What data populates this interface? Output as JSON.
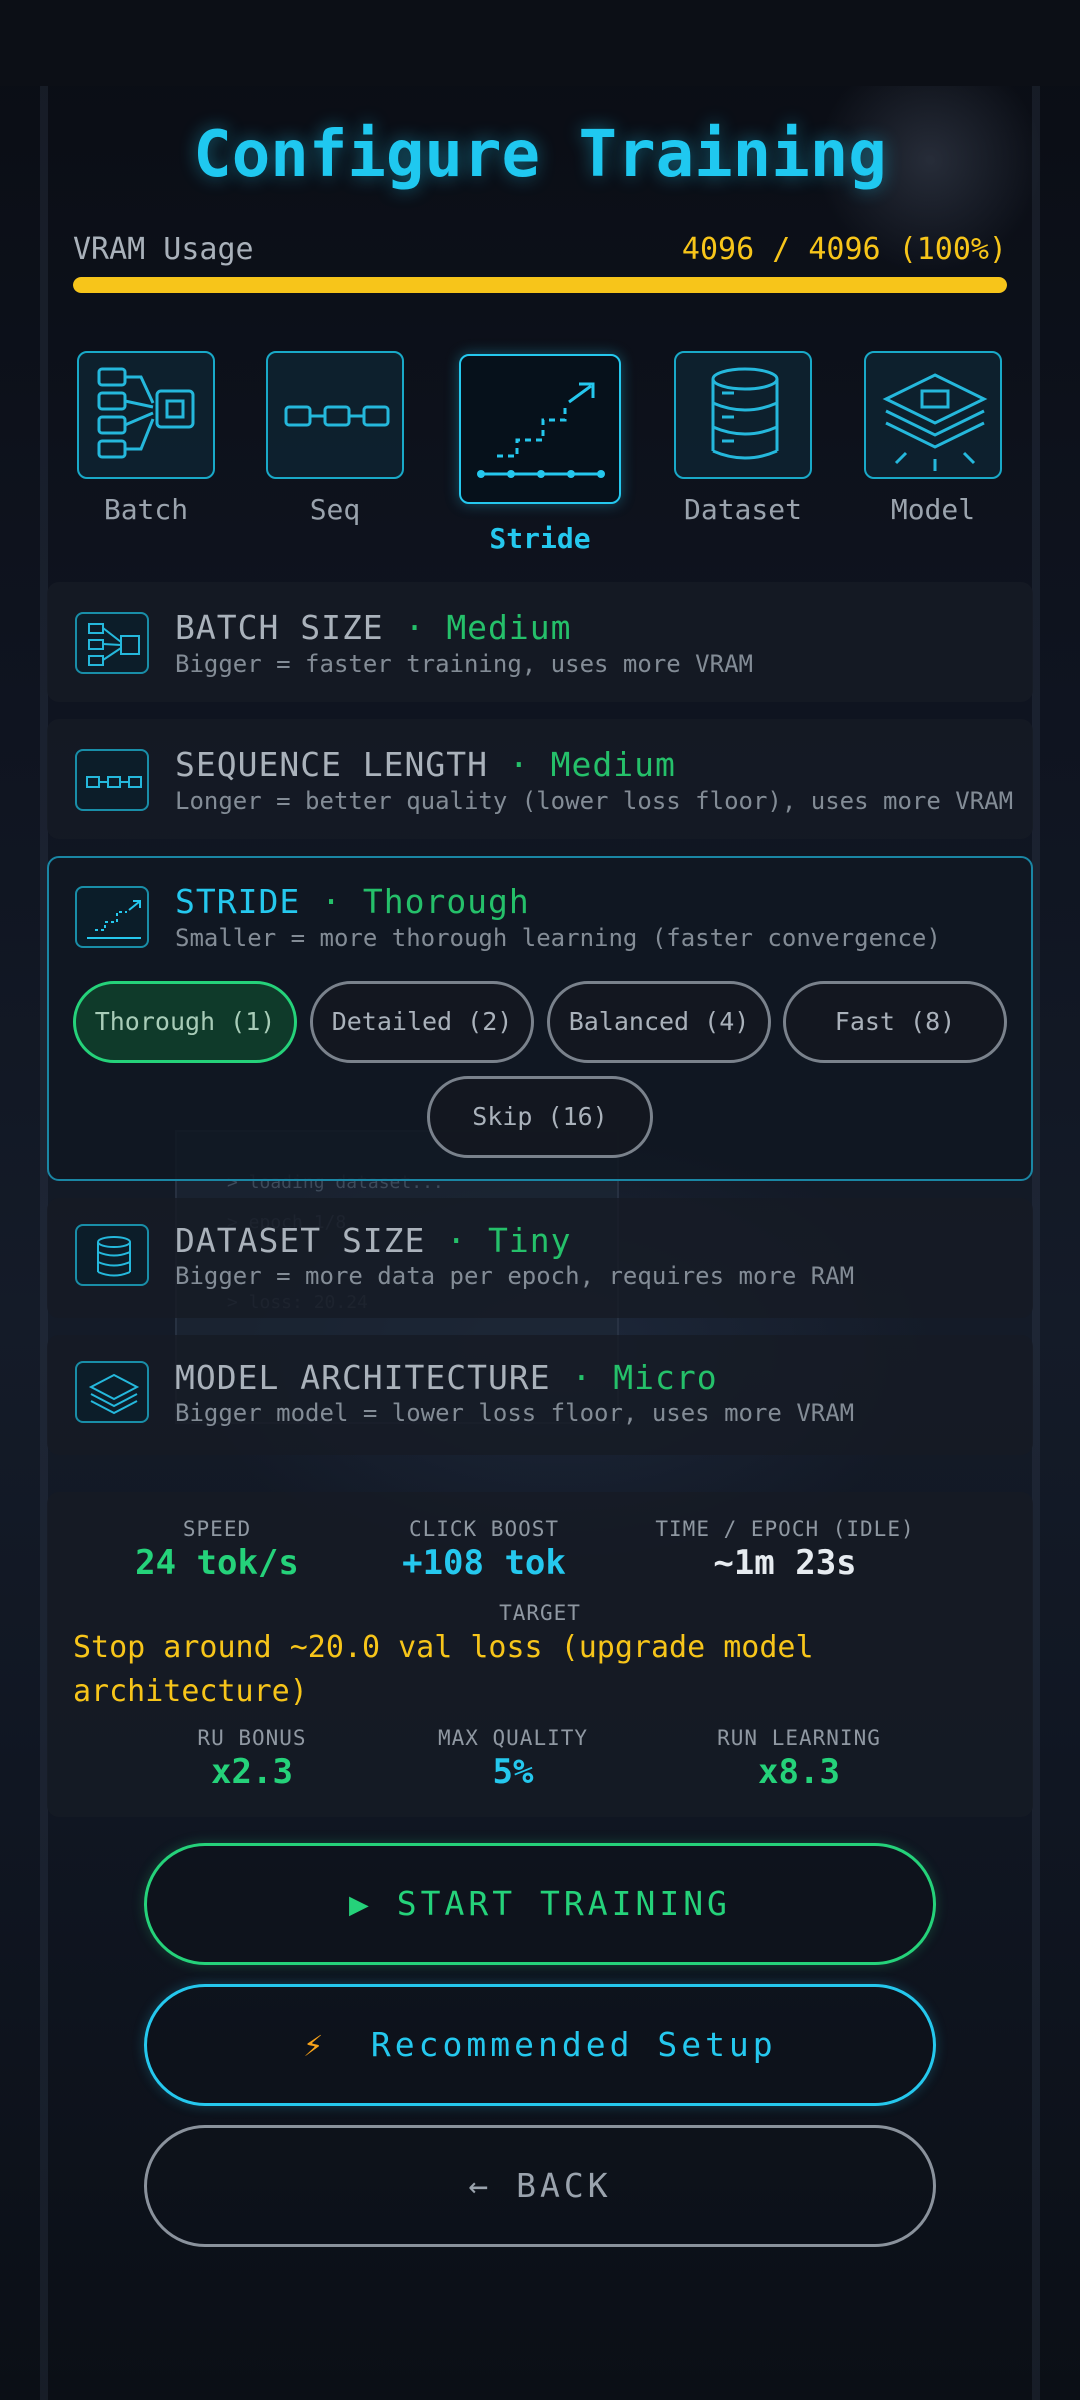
{
  "title": "Configure Training",
  "vram": {
    "label": "VRAM Usage",
    "value": "4096 / 4096 (100%)",
    "fill_fraction": 1.0,
    "color": "#f7c51a"
  },
  "tiles": [
    {
      "label": "Batch",
      "icon": "batch-icon"
    },
    {
      "label": "Seq",
      "icon": "sequence-icon"
    },
    {
      "label": "Stride",
      "icon": "stride-icon",
      "selected": true
    },
    {
      "label": "Dataset",
      "icon": "database-icon"
    },
    {
      "label": "Model",
      "icon": "model-layers-icon"
    }
  ],
  "rows": [
    {
      "name": "BATCH SIZE",
      "separator": "·",
      "level": "Medium",
      "desc": "Bigger = faster training, uses more VRAM"
    },
    {
      "name": "SEQUENCE LENGTH",
      "separator": "·",
      "level": "Medium",
      "desc": "Longer = better quality (lower loss floor), uses more VRAM"
    },
    {
      "name": "STRIDE",
      "separator": "·",
      "level": "Thorough",
      "desc": "Smaller = more thorough learning (faster convergence)"
    },
    {
      "name": "DATASET SIZE",
      "separator": "·",
      "level": "Tiny",
      "desc": "Bigger = more data per epoch, requires more RAM"
    },
    {
      "name": "MODEL ARCHITECTURE",
      "separator": "·",
      "level": "Micro",
      "desc": "Bigger model = lower loss floor, uses more VRAM"
    }
  ],
  "stride_options": [
    {
      "label": "Thorough (1)",
      "selected": true
    },
    {
      "label": "Detailed (2)"
    },
    {
      "label": "Balanced (4)"
    },
    {
      "label": "Fast (8)"
    },
    {
      "label": "Skip (16)"
    }
  ],
  "stats": {
    "speed": {
      "label": "SPEED",
      "value": "24 tok/s"
    },
    "click_boost": {
      "label": "CLICK BOOST",
      "value": "+108 tok"
    },
    "time_epoch": {
      "label": "TIME / EPOCH (IDLE)",
      "value": "~1m 23s"
    },
    "target_label": "TARGET",
    "target_text": "Stop around ~20.0 val loss (upgrade model architecture)",
    "ru_bonus": {
      "label": "RU BONUS",
      "value": "x2.3"
    },
    "max_quality": {
      "label": "MAX QUALITY",
      "value": "5%"
    },
    "run_learning": {
      "label": "RUN LEARNING",
      "value": "x8.3"
    }
  },
  "buttons": {
    "start": "▶  START TRAINING",
    "recommended_icon": "⚡",
    "recommended": "Recommended Setup",
    "back": "← BACK"
  },
  "colors": {
    "accent_cyan": "#25c8ee",
    "accent_green": "#25d27a",
    "warning_yellow": "#f7c51a"
  }
}
